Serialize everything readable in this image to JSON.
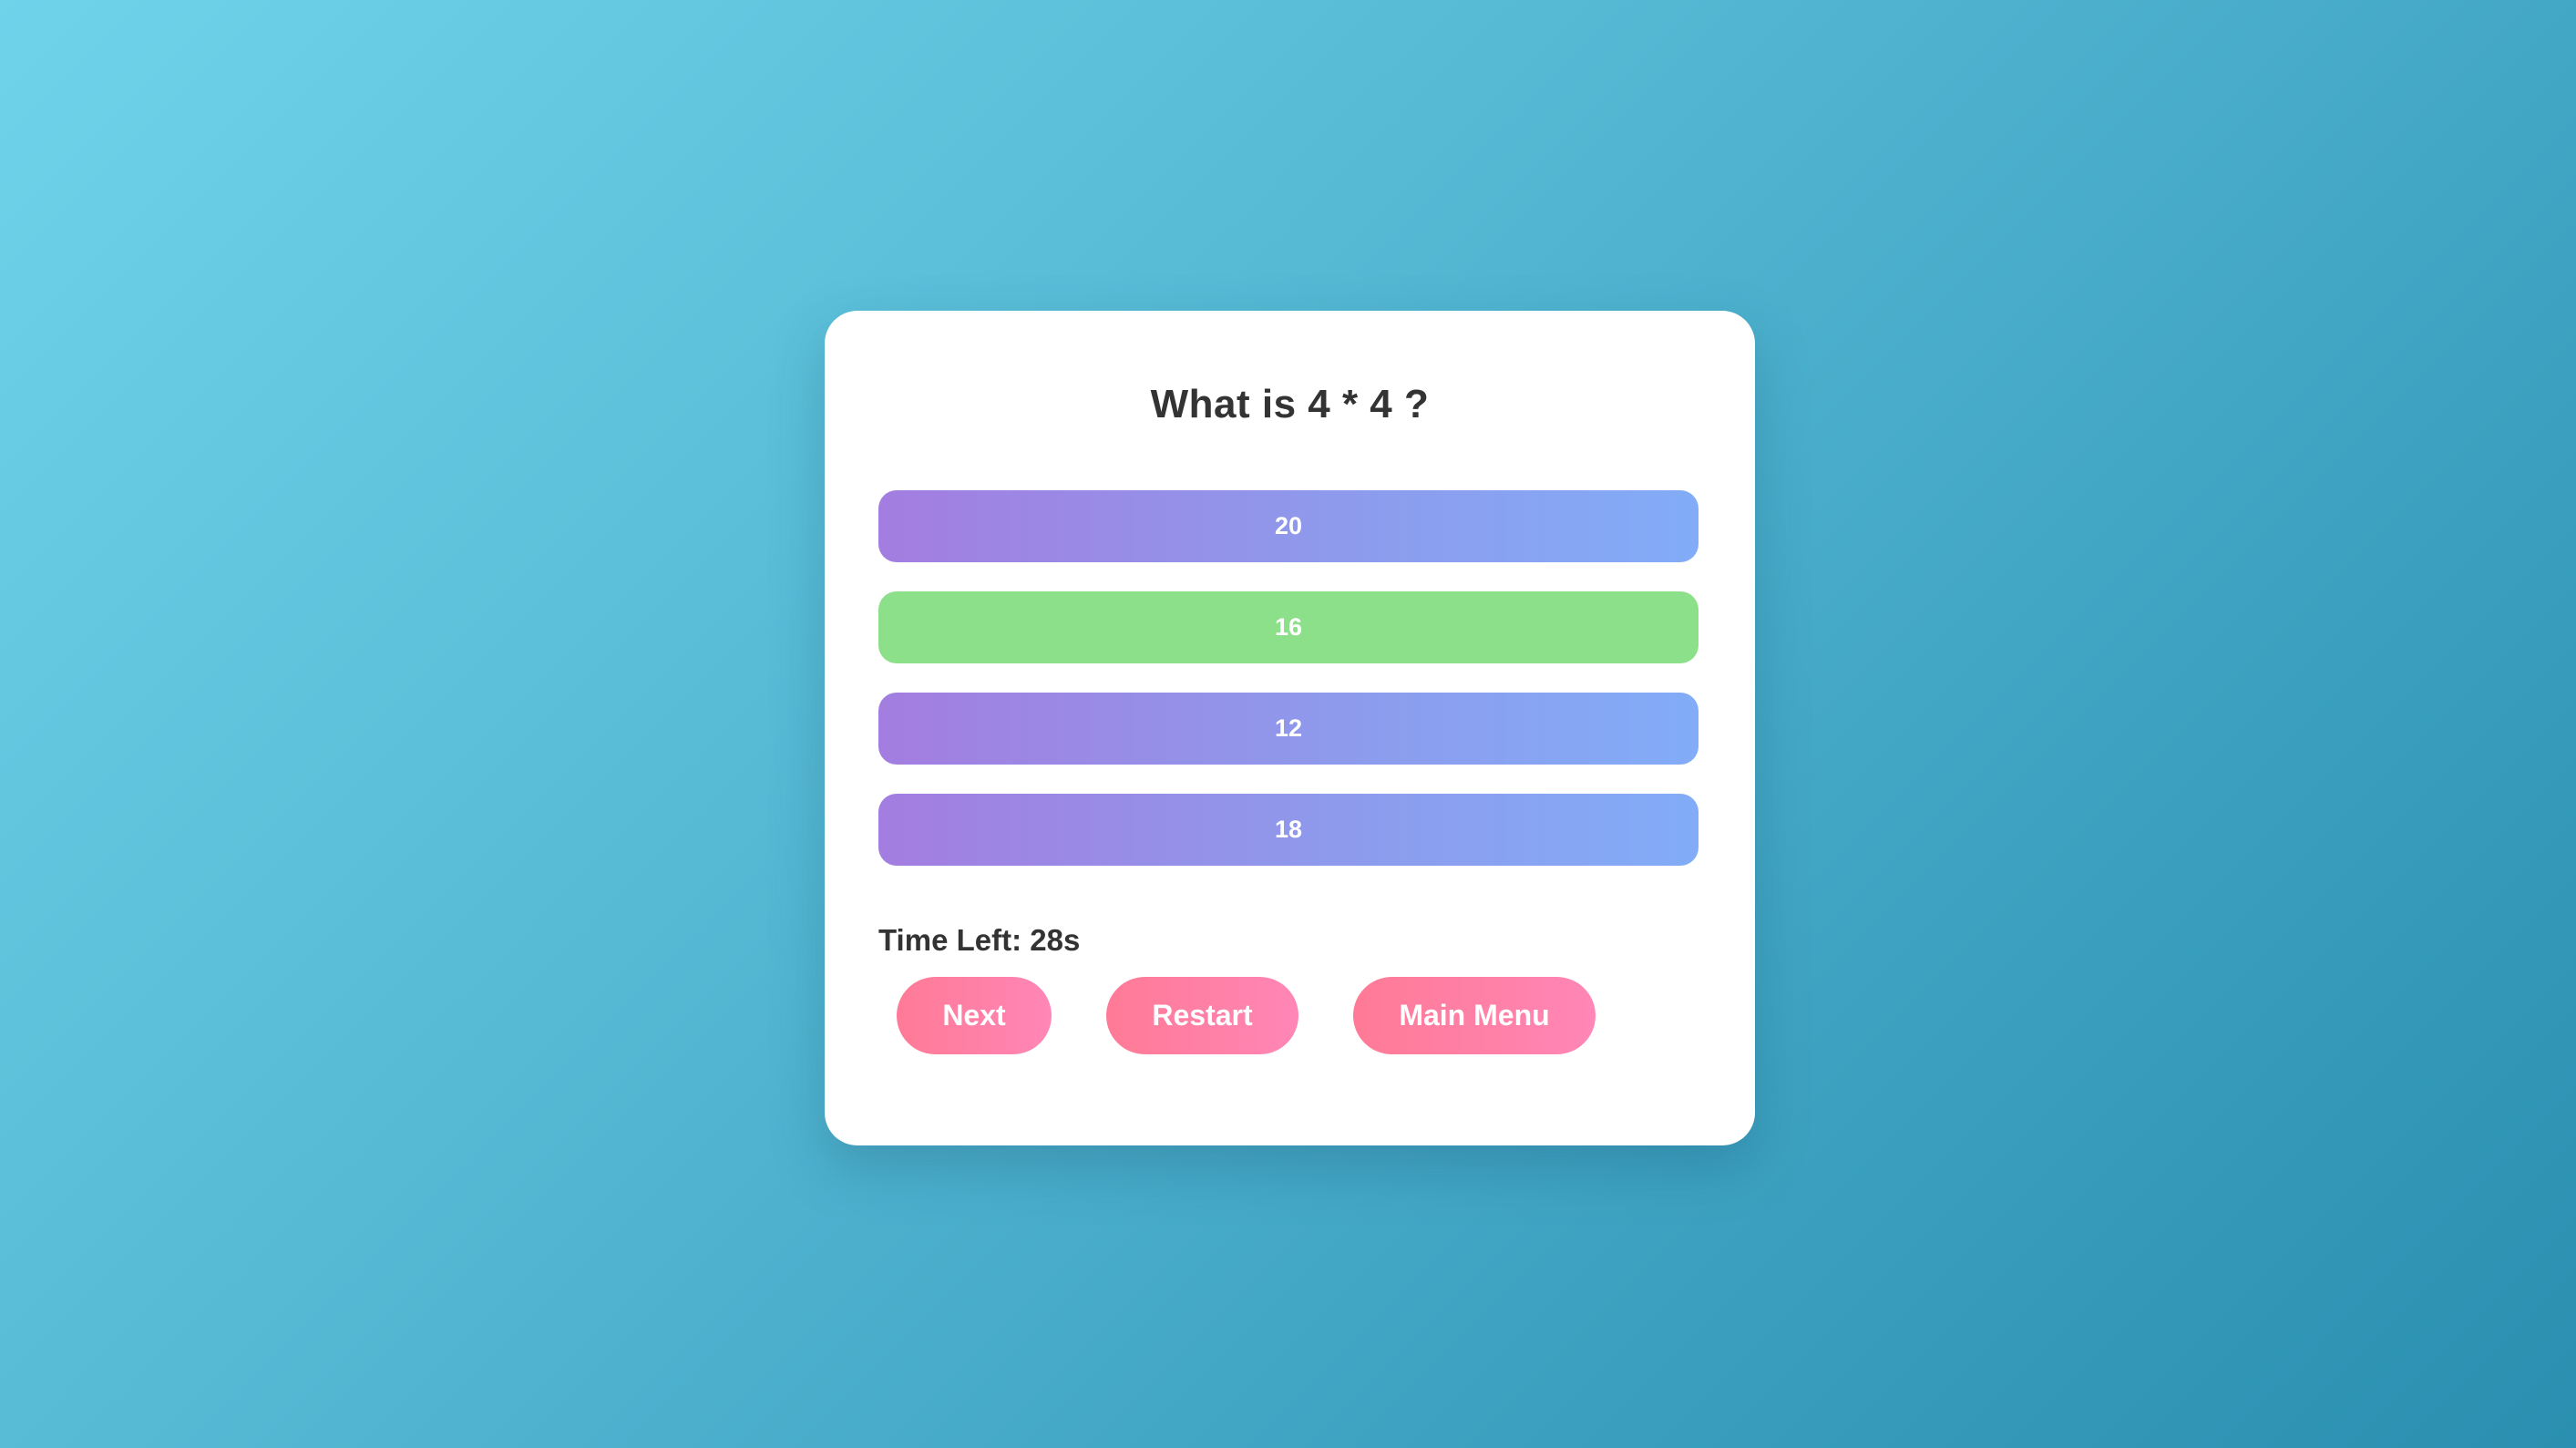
{
  "quiz": {
    "question": "What is 4 * 4 ?",
    "options": [
      {
        "label": "20",
        "state": "default"
      },
      {
        "label": "16",
        "state": "correct"
      },
      {
        "label": "12",
        "state": "default"
      },
      {
        "label": "18",
        "state": "default"
      }
    ],
    "timer_text": "Time Left: 28s",
    "buttons": {
      "next": "Next",
      "restart": "Restart",
      "main_menu": "Main Menu"
    }
  },
  "colors": {
    "option_gradient_start": "#a37de0",
    "option_gradient_end": "#82acf7",
    "correct": "#8de08a",
    "button_gradient_start": "#ff7a96",
    "button_gradient_end": "#ff86b6",
    "text_dark": "#333333"
  }
}
